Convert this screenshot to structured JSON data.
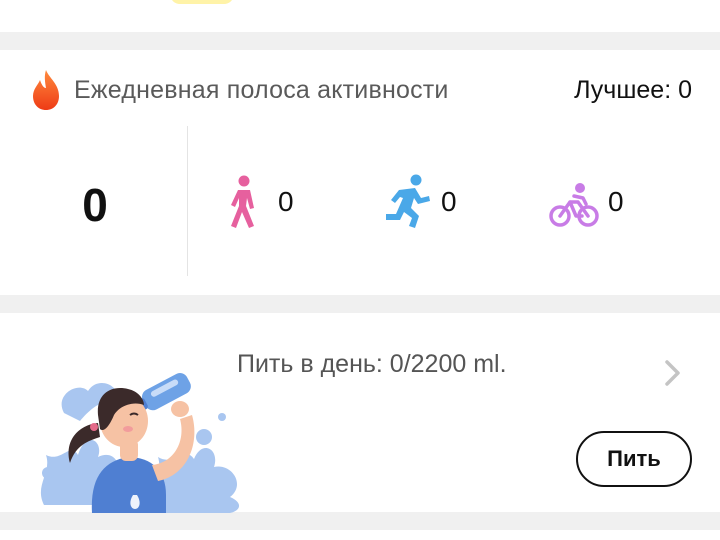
{
  "streak": {
    "title": "Ежедневная полоса активности",
    "best": "Лучшее: 0",
    "total": "0",
    "activities": [
      {
        "icon": "walking-icon",
        "count": "0",
        "color": "#e6609e"
      },
      {
        "icon": "running-icon",
        "count": "0",
        "color": "#4aa8e8"
      },
      {
        "icon": "cycling-icon",
        "count": "0",
        "color": "#c87ce6"
      }
    ]
  },
  "water": {
    "text": "Пить в день: 0/2200 ml.",
    "button": "Пить"
  },
  "colors": {
    "background": "#f0f0f0",
    "card": "#ffffff",
    "flame": "#f2571b"
  }
}
